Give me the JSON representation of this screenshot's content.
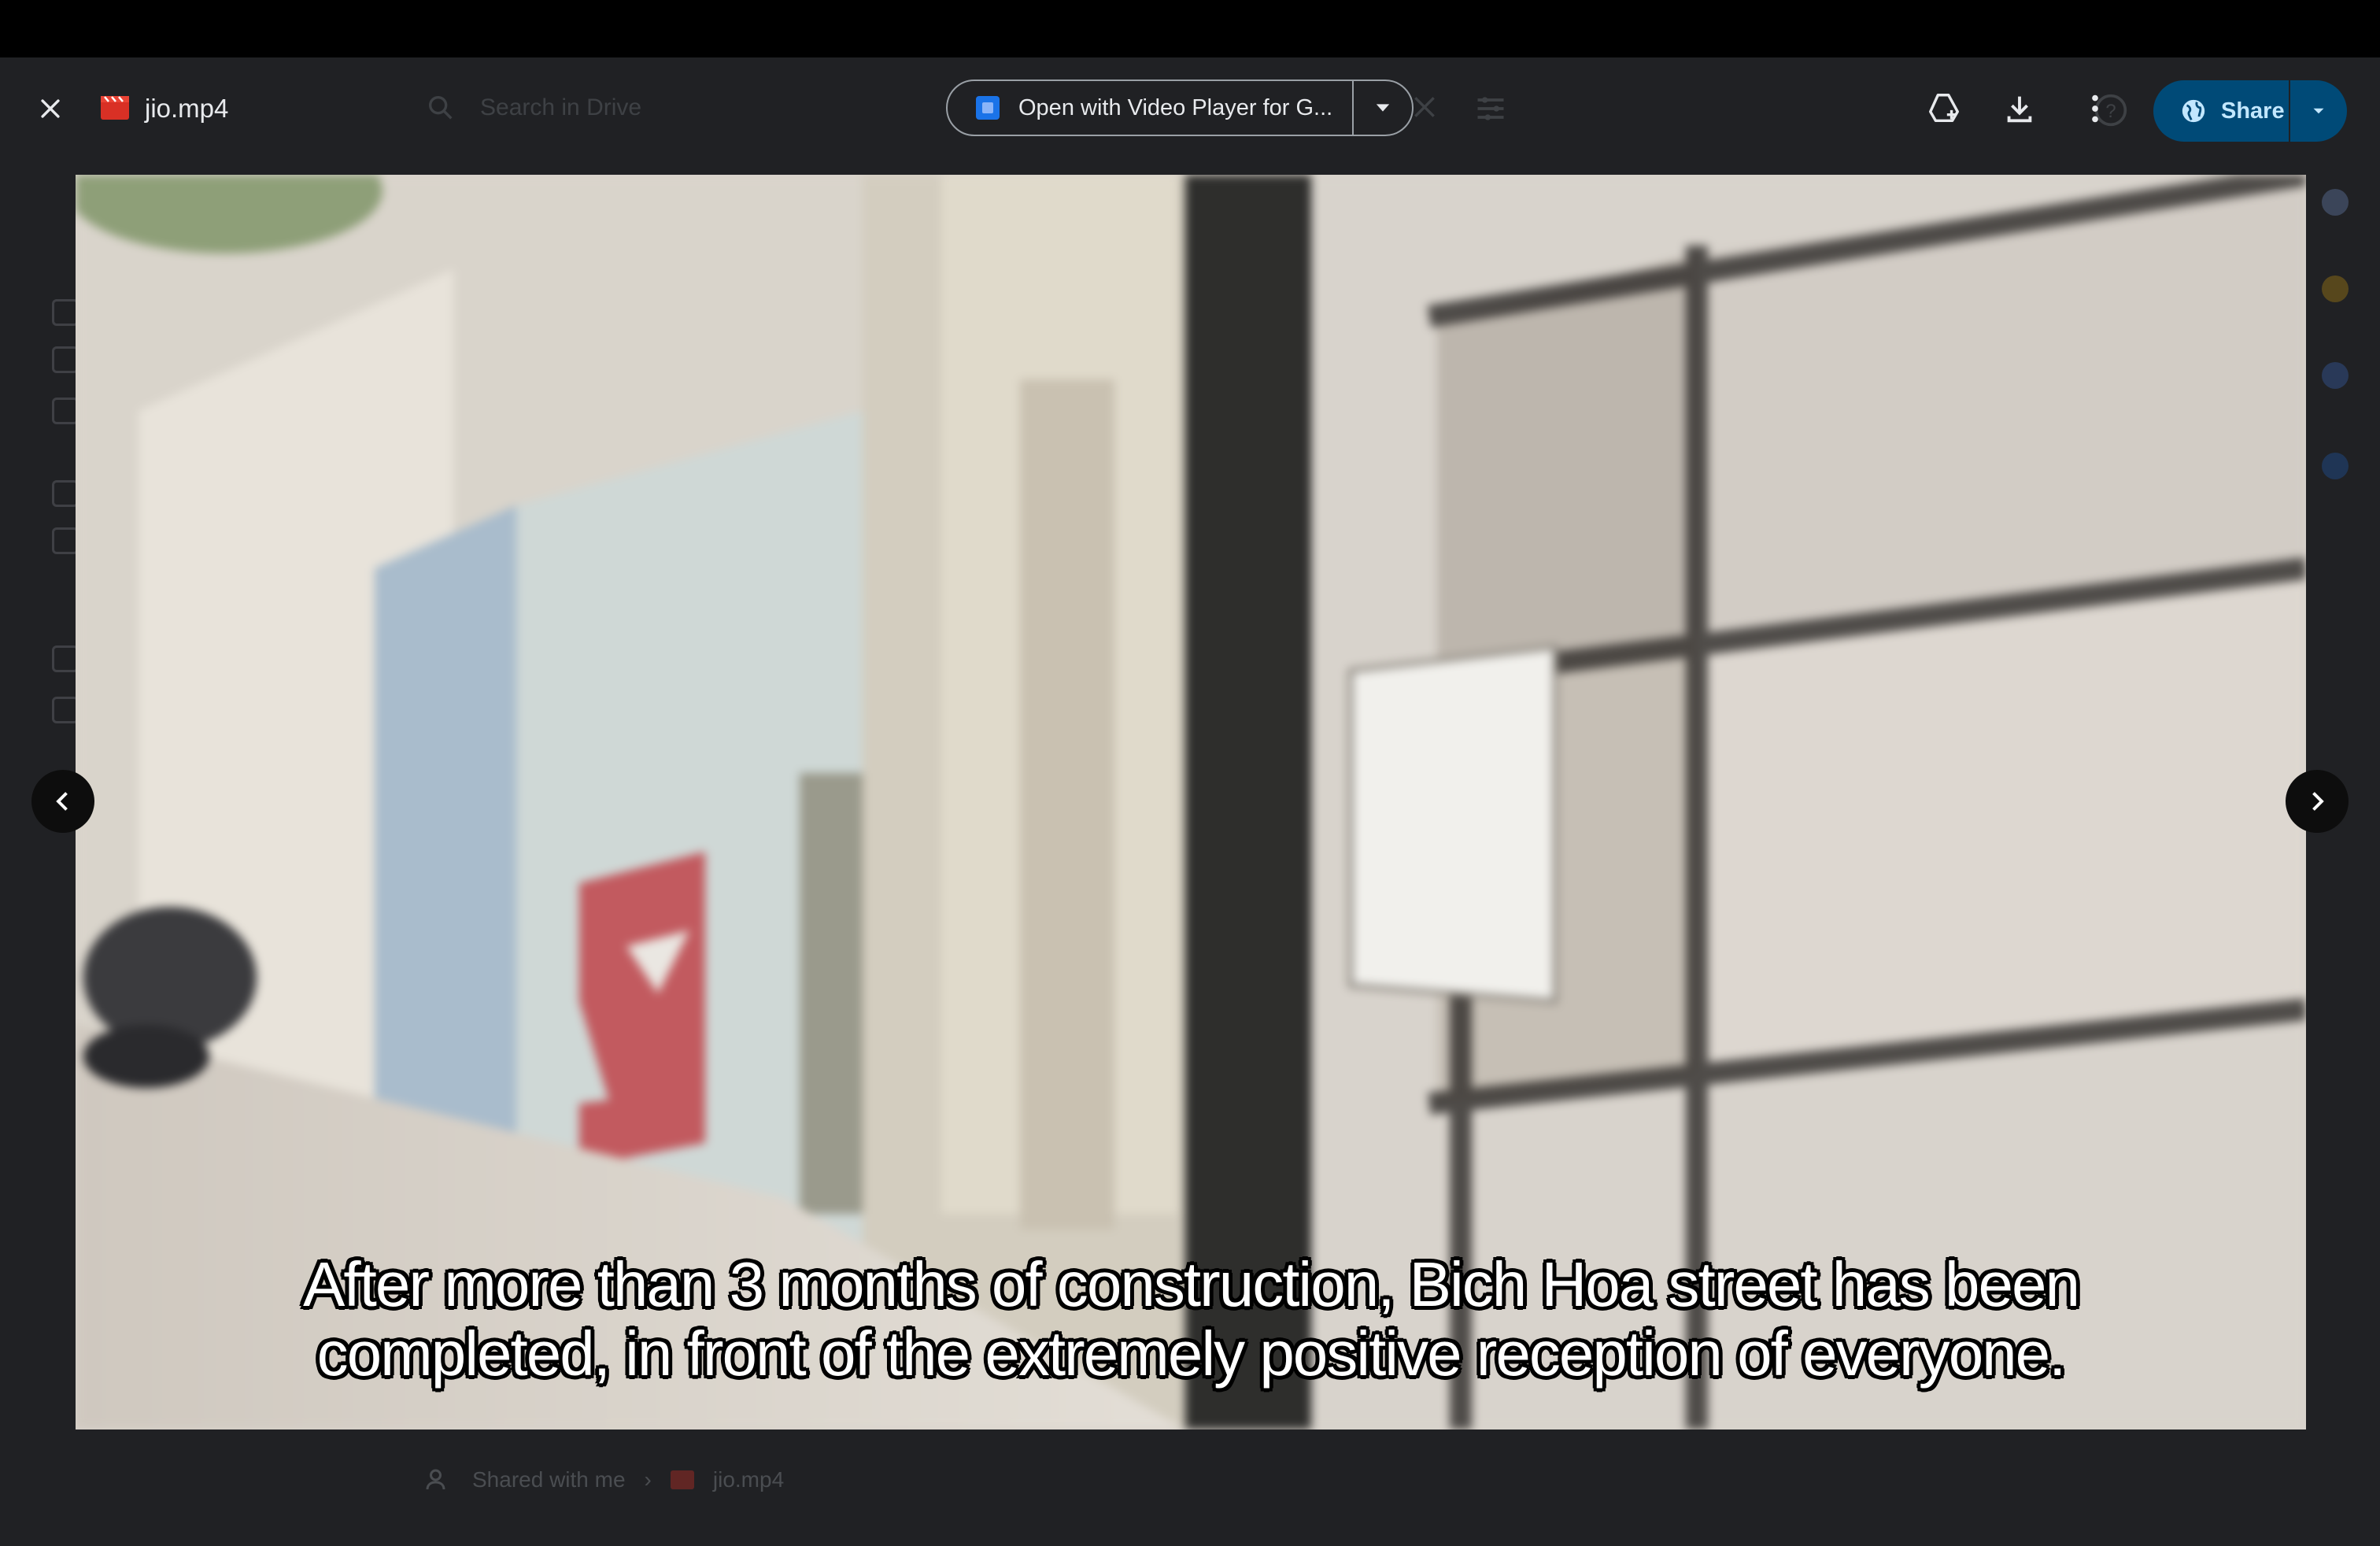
{
  "viewer": {
    "file_name": "jio.mp4",
    "open_with_label": "Open with Video Player for G...",
    "share_label": "Share"
  },
  "background": {
    "search_placeholder": "Search in Drive",
    "breadcrumb_parent": "Shared with me",
    "breadcrumb_file": "jio.mp4"
  },
  "video": {
    "subtitle_line1": "After more than 3 months of construction, Bich Hoa street has been",
    "subtitle_line2": "completed, in front of the extremely positive reception of everyone."
  },
  "icons": {
    "close": "close-icon",
    "file_type": "video-file-icon",
    "open_with_app": "video-player-app-icon",
    "dropdown": "arrow-drop-down-icon",
    "add_to_drive": "add-to-drive-icon",
    "download": "download-icon",
    "more": "more-vert-icon",
    "share": "globe-icon",
    "prev": "chevron-left-icon",
    "next": "chevron-right-icon"
  },
  "colors": {
    "app_background": "#202124",
    "top_strip": "#000000",
    "share_button": "#004a77",
    "share_text": "#c2e7ff",
    "file_icon_red": "#d93025"
  }
}
